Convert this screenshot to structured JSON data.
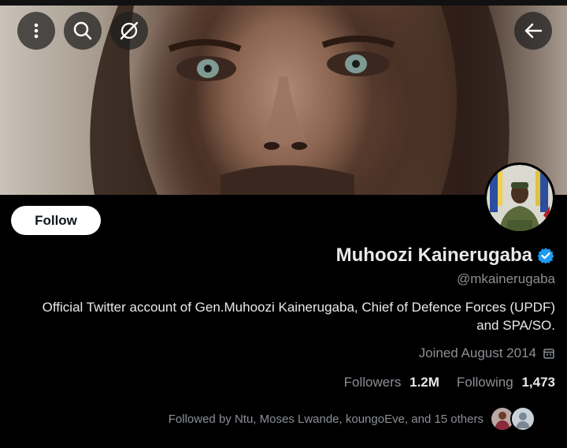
{
  "header": {
    "menu_icon": "more-vertical-icon",
    "search_icon": "search-icon",
    "grok_icon": "grok-icon",
    "back_icon": "back-arrow-icon"
  },
  "profile": {
    "follow_label": "Follow",
    "name": "Muhoozi Kainerugaba",
    "handle": "@mkainerugaba",
    "bio": "Official Twitter account of Gen.Muhoozi Kainerugaba, Chief of Defence Forces (UPDF) and SPA/SO.",
    "joined": "Joined August 2014",
    "followers_label": "Followers",
    "followers_count": "1.2M",
    "following_label": "Following",
    "following_count": "1,473",
    "followed_by": "Followed by Ntu, Moses Lwande, koungoEve, and 15 others"
  },
  "colors": {
    "verified_blue": "#1d9bf0",
    "background": "#000000",
    "secondary_text": "#8b8f94"
  }
}
